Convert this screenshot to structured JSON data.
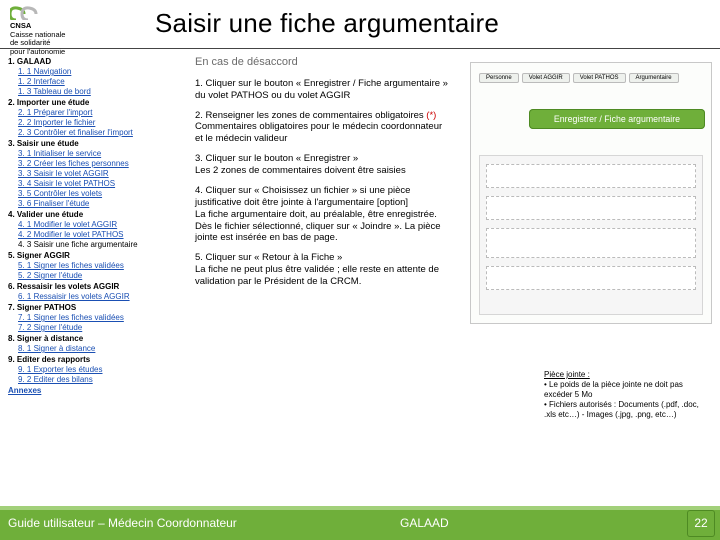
{
  "logo": {
    "line1": "CNSA",
    "line2": "Caisse nationale",
    "line3": "de solidarité",
    "line4": "pour l'autonomie"
  },
  "title": "Saisir une fiche argumentaire",
  "toc": [
    {
      "l": 0,
      "t": "1. GALAAD"
    },
    {
      "l": 1,
      "link": true,
      "t": "1. 1 Navigation"
    },
    {
      "l": 1,
      "link": true,
      "t": "1. 2 Interface"
    },
    {
      "l": 1,
      "link": true,
      "t": "1. 3 Tableau de bord"
    },
    {
      "l": 0,
      "t": "2. Importer une étude"
    },
    {
      "l": 1,
      "link": true,
      "t": "2. 1 Préparer l'import"
    },
    {
      "l": 1,
      "link": true,
      "t": "2. 2 Importer le fichier"
    },
    {
      "l": 1,
      "link": true,
      "t": "2. 3 Contrôler et finaliser l'import"
    },
    {
      "l": 0,
      "t": "3. Saisir une étude"
    },
    {
      "l": 1,
      "link": true,
      "t": "3. 1 Initialiser le service"
    },
    {
      "l": 1,
      "link": true,
      "t": "3. 2 Créer les fiches personnes"
    },
    {
      "l": 1,
      "link": true,
      "t": "3. 3 Saisir le volet AGGIR"
    },
    {
      "l": 1,
      "link": true,
      "t": "3. 4 Saisir le volet PATHOS"
    },
    {
      "l": 1,
      "link": true,
      "t": "3. 5 Contrôler les volets"
    },
    {
      "l": 1,
      "link": true,
      "t": "3. 6 Finaliser l'étude"
    },
    {
      "l": 0,
      "t": "4. Valider une étude"
    },
    {
      "l": 1,
      "link": true,
      "t": "4. 1 Modifier le volet AGGIR"
    },
    {
      "l": 1,
      "link": true,
      "t": "4. 2 Modifier le volet PATHOS"
    },
    {
      "l": 1,
      "t": "4. 3 Saisir une fiche argumentaire"
    },
    {
      "l": 0,
      "t": "5. Signer AGGIR"
    },
    {
      "l": 1,
      "link": true,
      "t": "5. 1 Signer les fiches validées"
    },
    {
      "l": 1,
      "link": true,
      "t": "5. 2 Signer l'étude"
    },
    {
      "l": 0,
      "t": "6. Ressaisir les volets AGGIR"
    },
    {
      "l": 1,
      "link": true,
      "t": "6. 1 Ressaisir les volets AGGIR"
    },
    {
      "l": 0,
      "t": "7. Signer PATHOS"
    },
    {
      "l": 1,
      "link": true,
      "t": "7. 1 Signer les fiches validées"
    },
    {
      "l": 1,
      "link": true,
      "t": "7. 2 Signer l'étude"
    },
    {
      "l": 0,
      "t": "8. Signer à distance"
    },
    {
      "l": 1,
      "link": true,
      "t": "8. 1 Signer à distance"
    },
    {
      "l": 0,
      "t": "9. Editer des rapports"
    },
    {
      "l": 1,
      "link": true,
      "t": "9. 1 Exporter les études"
    },
    {
      "l": 1,
      "link": true,
      "t": "9. 2 Editer des bilans"
    },
    {
      "l": 0,
      "link": true,
      "t": "Annexes"
    }
  ],
  "mid": {
    "hd": "En cas de désaccord",
    "s1": "1. Cliquer sur le bouton « Enregistrer / Fiche argumentaire » du volet PATHOS ou du volet AGGIR",
    "s2a": "2. Renseigner les zones de commentaires obligatoires ",
    "s2b": "(*)",
    "s2c": "Commentaires obligatoires pour le médecin coordonnateur et le médecin valideur",
    "s3": "3. Cliquer sur le bouton « Enregistrer »\nLes 2 zones de commentaires doivent être saisies",
    "s4": "4. Cliquer sur « Choisissez un fichier » si une pièce justificative doit être jointe à l'argumentaire [option]\nLa fiche argumentaire doit, au préalable, être enregistrée. Dès le fichier sélectionné, cliquer sur « Joindre ». La pièce jointe est insérée en bas de page.",
    "s5": "5. Cliquer sur « Retour à la Fiche »\nLa fiche ne peut plus être validée ; elle reste en attente de validation par le Président de la CRCM."
  },
  "shot": {
    "tabs": [
      "Personne",
      "Volet AGGIR",
      "Volet PATHOS",
      "Argumentaire"
    ],
    "button": "Enregistrer / Fiche argumentaire"
  },
  "attach": {
    "t": "Pièce jointe :",
    "l1": "• Le poids de la pièce jointe ne doit pas excéder 5 Mo",
    "l2": "• Fichiers autorisés : Documents (.pdf, .doc, .xls etc…) - Images (.jpg, .png, etc…)"
  },
  "footer": {
    "left": "Guide utilisateur – Médecin Coordonnateur",
    "center": "GALAAD",
    "page": "22"
  }
}
